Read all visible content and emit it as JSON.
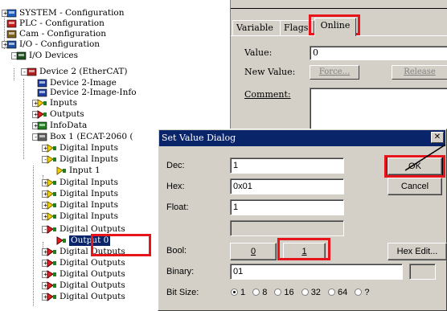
{
  "colors": {
    "highlight": "#e8141b",
    "selection": "#0a246a",
    "dialog_bg": "#d4d0c8"
  },
  "tree": {
    "items": [
      {
        "label": "SYSTEM - Configuration",
        "icon": "system-config-icon"
      },
      {
        "label": "PLC - Configuration",
        "icon": "plc-config-icon"
      },
      {
        "label": "Cam - Configuration",
        "icon": "cam-config-icon"
      },
      {
        "label": "I/O - Configuration",
        "icon": "io-config-icon"
      },
      {
        "label": "I/O Devices",
        "icon": "io-devices-icon"
      },
      {
        "label": "Device 2 (EtherCAT)",
        "icon": "ethercat-device-icon"
      },
      {
        "label": "Device 2-Image",
        "icon": "device-image-icon"
      },
      {
        "label": "Device 2-Image-Info",
        "icon": "device-image-info-icon"
      },
      {
        "label": "Inputs",
        "icon": "inputs-icon"
      },
      {
        "label": "Outputs",
        "icon": "outputs-icon"
      },
      {
        "label": "InfoData",
        "icon": "infodata-icon"
      },
      {
        "label": "Box 1 (ECAT-2060 (",
        "icon": "box-icon"
      },
      {
        "label": "Digital Inputs",
        "icon": "digital-input-icon"
      },
      {
        "label": "Digital Inputs",
        "icon": "digital-input-icon"
      },
      {
        "label": "Input 1",
        "icon": "input-channel-icon"
      },
      {
        "label": "Digital Inputs",
        "icon": "digital-input-icon"
      },
      {
        "label": "Digital Inputs",
        "icon": "digital-input-icon"
      },
      {
        "label": "Digital Inputs",
        "icon": "digital-input-icon"
      },
      {
        "label": "Digital Inputs",
        "icon": "digital-input-icon"
      },
      {
        "label": "Digital Outputs",
        "icon": "digital-output-icon"
      },
      {
        "label": "Output 0",
        "icon": "output-channel-icon"
      },
      {
        "label": "Digital Outputs",
        "icon": "digital-output-icon"
      },
      {
        "label": "Digital Outputs",
        "icon": "digital-output-icon"
      },
      {
        "label": "Digital Outputs",
        "icon": "digital-output-icon"
      },
      {
        "label": "Digital Outputs",
        "icon": "digital-output-icon"
      },
      {
        "label": "Digital Outputs",
        "icon": "digital-output-icon"
      }
    ]
  },
  "panel": {
    "tabs": [
      "Variable",
      "Flags",
      "Online"
    ],
    "active_tab": "Online",
    "value_label": "Value:",
    "value": "0",
    "new_value_label": "New Value:",
    "force_button": "Force...",
    "release_button": "Release",
    "comment_label": "Comment:"
  },
  "dialog": {
    "title": "Set Value Dialog",
    "close_glyph": "✕",
    "dec_label": "Dec:",
    "dec_value": "1",
    "hex_label": "Hex:",
    "hex_value": "0x01",
    "float_label": "Float:",
    "float_value": "1",
    "bool_label": "Bool:",
    "bool_false": "0",
    "bool_true": "1",
    "binary_label": "Binary:",
    "binary_value": "01",
    "bitsize_label": "Bit Size:",
    "bitsize_options": [
      "1",
      "8",
      "16",
      "32",
      "64",
      "?"
    ],
    "bitsize_selected": "1",
    "ok_button": "OK",
    "cancel_button": "Cancel",
    "hex_edit_button": "Hex Edit..."
  }
}
